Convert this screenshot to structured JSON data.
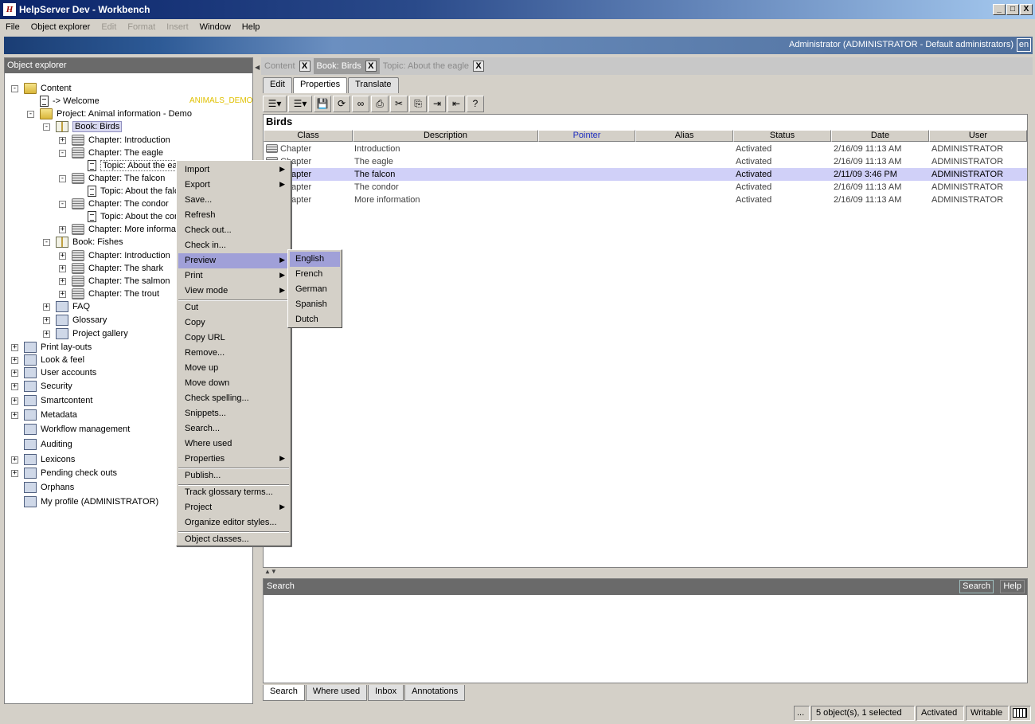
{
  "window": {
    "title": "HelpServer Dev - Workbench",
    "app_icon_glyph": "H",
    "min": "_",
    "max": "□",
    "close": "X"
  },
  "menubar": [
    {
      "label": "File",
      "enabled": true
    },
    {
      "label": "Object explorer",
      "enabled": true
    },
    {
      "label": "Edit",
      "enabled": false
    },
    {
      "label": "Format",
      "enabled": false
    },
    {
      "label": "Insert",
      "enabled": false
    },
    {
      "label": "Window",
      "enabled": true
    },
    {
      "label": "Help",
      "enabled": true
    }
  ],
  "banner": {
    "user": "Administrator (ADMINISTRATOR - Default administrators)",
    "lang": "en"
  },
  "explorer": {
    "title": "Object explorer",
    "tag": "ANIMALS_DEMO",
    "items": [
      {
        "label": "Content",
        "exp": "-",
        "icon": "folder-icon"
      },
      {
        "label": "-> Welcome",
        "exp": "",
        "icon": "page-icon"
      },
      {
        "label": "Project: Animal information - Demo",
        "exp": "-",
        "icon": "project-folder-icon"
      },
      {
        "label": "Book: Birds",
        "exp": "-",
        "icon": "book-icon"
      },
      {
        "label": "Chapter: Introduction",
        "exp": "+",
        "icon": "chapter-icon"
      },
      {
        "label": "Chapter: The eagle",
        "exp": "-",
        "icon": "chapter-icon"
      },
      {
        "label": "Topic: About the eagle",
        "exp": "",
        "icon": "topic-icon"
      },
      {
        "label": "Chapter: The falcon",
        "exp": "-",
        "icon": "chapter-icon"
      },
      {
        "label": "Topic: About the falcon",
        "exp": "",
        "icon": "topic-icon"
      },
      {
        "label": "Chapter: The condor",
        "exp": "-",
        "icon": "chapter-icon"
      },
      {
        "label": "Topic: About the condor",
        "exp": "",
        "icon": "topic-icon"
      },
      {
        "label": "Chapter: More information",
        "exp": "+",
        "icon": "chapter-icon"
      },
      {
        "label": "Book: Fishes",
        "exp": "-",
        "icon": "book-icon"
      },
      {
        "label": "Chapter: Introduction",
        "exp": "+",
        "icon": "chapter-icon"
      },
      {
        "label": "Chapter: The shark",
        "exp": "+",
        "icon": "chapter-icon"
      },
      {
        "label": "Chapter: The salmon",
        "exp": "+",
        "icon": "chapter-icon"
      },
      {
        "label": "Chapter: The trout",
        "exp": "+",
        "icon": "chapter-icon"
      },
      {
        "label": "FAQ",
        "exp": "+",
        "icon": "faq-icon"
      },
      {
        "label": "Glossary",
        "exp": "+",
        "icon": "glossary-icon"
      },
      {
        "label": "Project gallery",
        "exp": "+",
        "icon": "gallery-icon"
      },
      {
        "label": "Print lay-outs",
        "exp": "+",
        "icon": "printer-icon"
      },
      {
        "label": "Look & feel",
        "exp": "+",
        "icon": "monitor-icon"
      },
      {
        "label": "User accounts",
        "exp": "+",
        "icon": "users-icon"
      },
      {
        "label": "Security",
        "exp": "+",
        "icon": "lock-icon"
      },
      {
        "label": "Smartcontent",
        "exp": "+",
        "icon": "smartcontent-icon"
      },
      {
        "label": "Metadata",
        "exp": "+",
        "icon": "metadata-icon"
      },
      {
        "label": "Workflow management",
        "exp": "",
        "icon": "briefcase-icon"
      },
      {
        "label": "Auditing",
        "exp": "",
        "icon": "chart-icon"
      },
      {
        "label": "Lexicons",
        "exp": "+",
        "icon": "spellcheck-icon"
      },
      {
        "label": "Pending check outs",
        "exp": "+",
        "icon": "checkout-icon"
      },
      {
        "label": "Orphans",
        "exp": "",
        "icon": "orphans-icon"
      },
      {
        "label": "My profile (ADMINISTRATOR)",
        "exp": "",
        "icon": "profile-icon"
      }
    ]
  },
  "doc_tabs": [
    {
      "label": "Content",
      "active": false
    },
    {
      "label": "Book: Birds",
      "active": true
    },
    {
      "label": "Topic: About the eagle",
      "active": false
    }
  ],
  "close_glyph": "X",
  "sub_tabs": [
    "Edit",
    "Properties",
    "Translate"
  ],
  "toolbar_icons": [
    "insert-dropdown-icon",
    "add-dropdown-icon",
    "save-icon",
    "refresh-icon",
    "preview-icon",
    "print-icon",
    "cut-icon",
    "copy-icon",
    "indent-icon",
    "outdent-icon",
    "help-icon"
  ],
  "content": {
    "title": "Birds",
    "columns": [
      "Class",
      "Description",
      "Pointer",
      "Alias",
      "Status",
      "Date",
      "User"
    ],
    "rows": [
      {
        "class": "Chapter",
        "desc": "Introduction",
        "status": "Activated",
        "date": "2/16/09 11:13 AM",
        "user": "ADMINISTRATOR",
        "sel": false
      },
      {
        "class": "Chapter",
        "desc": "The eagle",
        "status": "Activated",
        "date": "2/16/09 11:13 AM",
        "user": "ADMINISTRATOR",
        "sel": false
      },
      {
        "class": "Chapter",
        "desc": "The falcon",
        "status": "Activated",
        "date": "2/11/09 3:46 PM",
        "user": "ADMINISTRATOR",
        "sel": true
      },
      {
        "class": "Chapter",
        "desc": "The condor",
        "status": "Activated",
        "date": "2/16/09 11:13 AM",
        "user": "ADMINISTRATOR",
        "sel": false
      },
      {
        "class": "Chapter",
        "desc": "More information",
        "status": "Activated",
        "date": "2/16/09 11:13 AM",
        "user": "ADMINISTRATOR",
        "sel": false
      }
    ]
  },
  "search_panel": {
    "title": "Search",
    "search_btn": "Search",
    "help_btn": "Help"
  },
  "bottom_tabs": [
    "Search",
    "Where used",
    "Inbox",
    "Annotations"
  ],
  "status": {
    "ellipsis": "...",
    "count": "5 object(s), 1 selected",
    "state": "Activated",
    "mode": "Writable"
  },
  "context_menu": [
    {
      "label": "Import",
      "sub": true
    },
    {
      "label": "Export",
      "sub": true
    },
    {
      "label": "Save...",
      "sub": false
    },
    {
      "label": "Refresh",
      "sub": false
    },
    {
      "label": "Check out...",
      "sub": false
    },
    {
      "label": "Check in...",
      "sub": false
    },
    {
      "label": "Preview",
      "sub": true,
      "hover": true
    },
    {
      "label": "Print",
      "sub": true
    },
    {
      "label": "View mode",
      "sub": true
    },
    {
      "sep": true
    },
    {
      "label": "Cut",
      "sub": false
    },
    {
      "label": "Copy",
      "sub": false
    },
    {
      "label": "Copy URL",
      "sub": false
    },
    {
      "label": "Remove...",
      "sub": false
    },
    {
      "label": "Move up",
      "sub": false
    },
    {
      "label": "Move down",
      "sub": false
    },
    {
      "label": "Check spelling...",
      "sub": false
    },
    {
      "label": "Snippets...",
      "sub": false
    },
    {
      "label": "Search...",
      "sub": false
    },
    {
      "label": "Where used",
      "sub": false
    },
    {
      "label": "Properties",
      "sub": true
    },
    {
      "sep": true
    },
    {
      "label": "Publish...",
      "sub": false
    },
    {
      "sep": true
    },
    {
      "label": "Track glossary terms...",
      "sub": false
    },
    {
      "label": "Project",
      "sub": true
    },
    {
      "label": "Organize editor styles...",
      "sub": false
    },
    {
      "sep": true
    },
    {
      "label": "Object classes...",
      "sub": false
    }
  ],
  "preview_submenu": [
    "English",
    "French",
    "German",
    "Spanish",
    "Dutch"
  ]
}
